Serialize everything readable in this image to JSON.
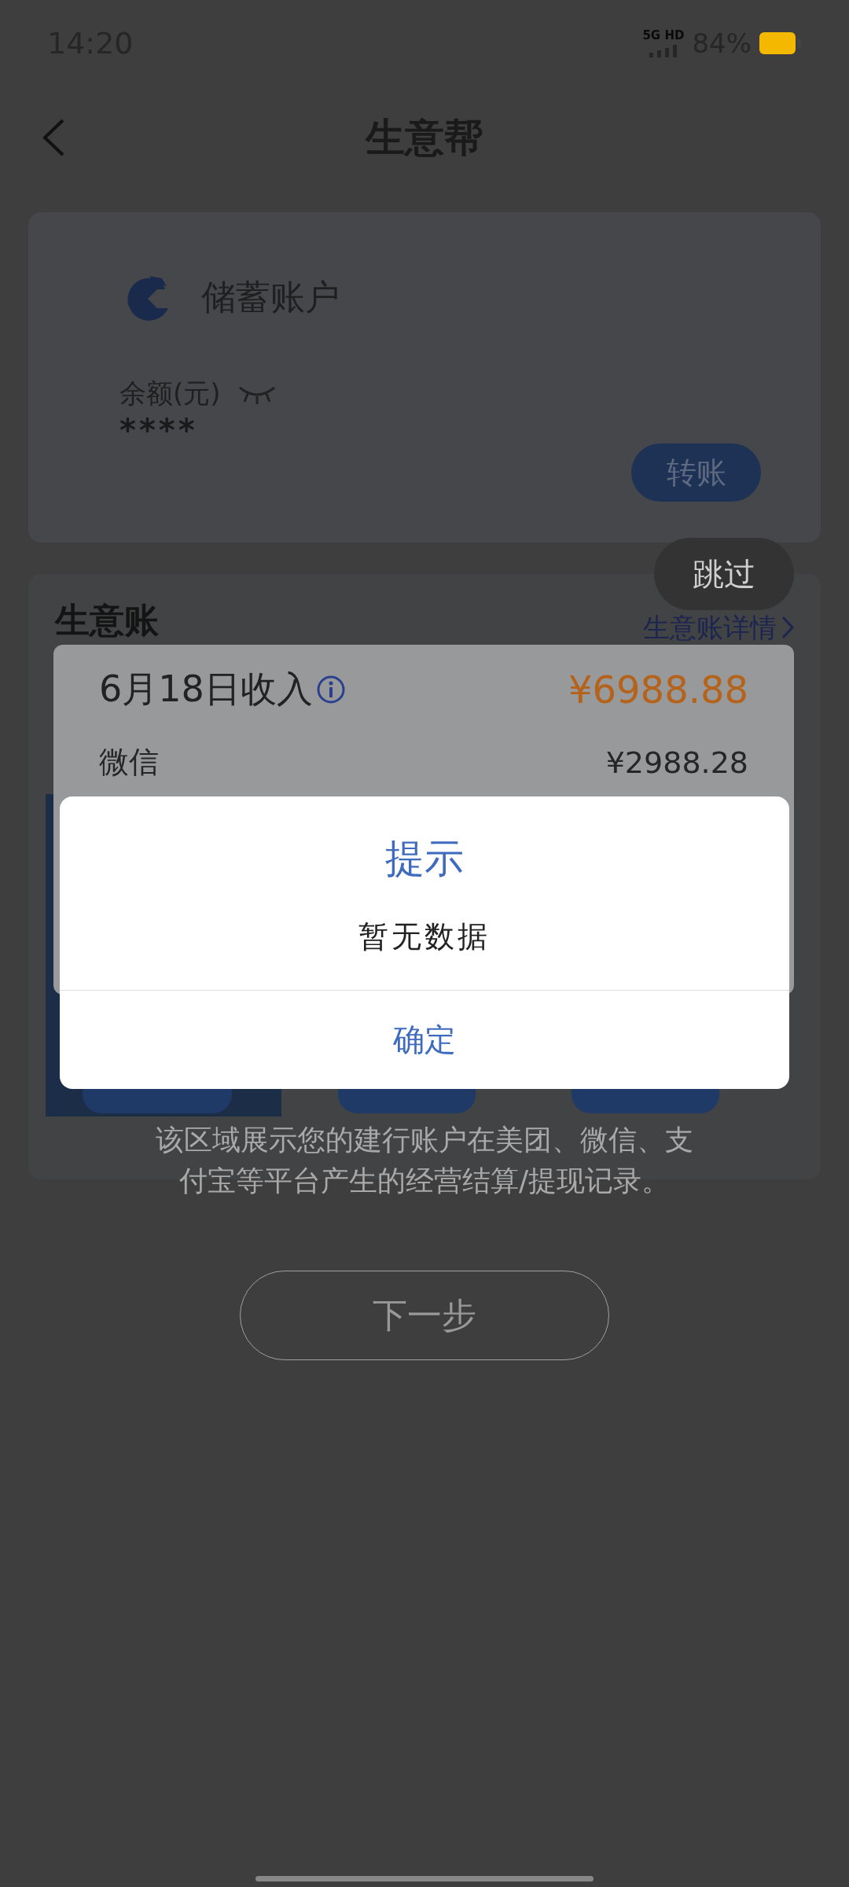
{
  "status_bar": {
    "time": "14:20",
    "network": "5G HD",
    "battery_text": "84%"
  },
  "header": {
    "title": "生意帮"
  },
  "account_card": {
    "name": "储蓄账户",
    "balance_label": "余额(元)",
    "balance": "****",
    "transfer_button": "转账"
  },
  "business": {
    "title": "生意账",
    "detail_link": "生意账详情"
  },
  "guide": {
    "skip": "跳过",
    "income_card": {
      "title": "6月18日收入",
      "total": "¥6988.88",
      "rows": [
        {
          "label": "微信",
          "amount": "¥2988.28"
        }
      ]
    },
    "description": "该区域展示您的建行账户在美团、微信、支付宝等平台产生的经营结算/提现记录。",
    "next_button": "下一步"
  },
  "dialog": {
    "title": "提示",
    "message": "暂无数据",
    "confirm": "确定"
  }
}
